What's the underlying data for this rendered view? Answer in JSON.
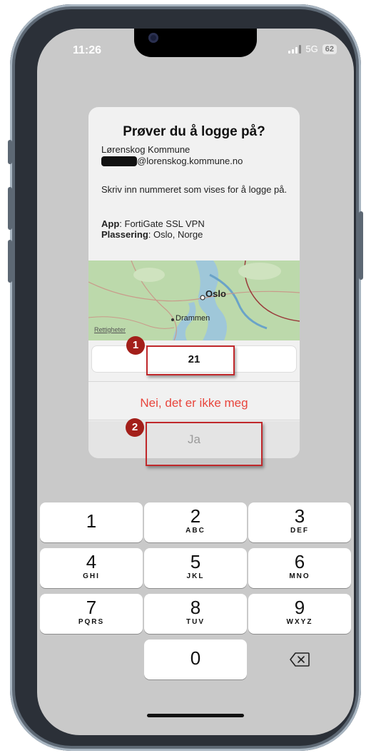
{
  "status_bar": {
    "time": "11:26",
    "network": "5G",
    "battery": "62"
  },
  "dialog": {
    "title": "Prøver du å logge på?",
    "organization": "Lørenskog Kommune",
    "email_domain": "@lorenskog.kommune.no",
    "instruction": "Skriv inn nummeret som vises for å logge på.",
    "app_label": "App",
    "app_value": ": FortiGate SSL VPN",
    "location_label": "Plassering",
    "location_value": ": Oslo, Norge",
    "map": {
      "city_main": "Oslo",
      "city_secondary": "Drammen",
      "legal": "Rettigheter"
    },
    "code_value": "21",
    "deny_label": "Nei, det er ikke meg",
    "confirm_label": "Ja"
  },
  "annotations": [
    {
      "number": "1",
      "color": "#a31f1a"
    },
    {
      "number": "2",
      "color": "#a31f1a"
    }
  ],
  "keypad": {
    "keys": [
      {
        "digit": "1",
        "letters": ""
      },
      {
        "digit": "2",
        "letters": "ABC"
      },
      {
        "digit": "3",
        "letters": "DEF"
      },
      {
        "digit": "4",
        "letters": "GHI"
      },
      {
        "digit": "5",
        "letters": "JKL"
      },
      {
        "digit": "6",
        "letters": "MNO"
      },
      {
        "digit": "7",
        "letters": "PQRS"
      },
      {
        "digit": "8",
        "letters": "TUV"
      },
      {
        "digit": "9",
        "letters": "WXYZ"
      },
      {
        "digit": "0",
        "letters": ""
      }
    ],
    "backspace_icon": "backspace-icon"
  },
  "colors": {
    "deny": "#e8453c",
    "highlight": "#c0282b",
    "screen_background": "#c9c9c9"
  }
}
